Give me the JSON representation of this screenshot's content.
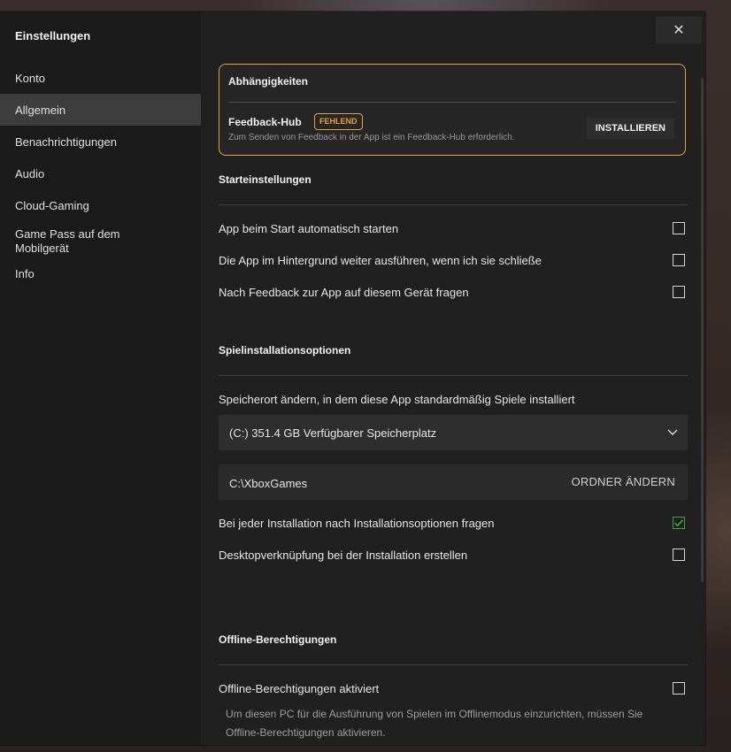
{
  "sidebar": {
    "title": "Einstellungen",
    "items": [
      {
        "label": "Konto"
      },
      {
        "label": "Allgemein"
      },
      {
        "label": "Benachrichtigungen"
      },
      {
        "label": "Audio"
      },
      {
        "label": "Cloud-Gaming"
      },
      {
        "label": "Game Pass auf dem Mobilgerät"
      },
      {
        "label": "Info"
      }
    ],
    "active": "Allgemein"
  },
  "window": {
    "close_icon": "close-icon",
    "close_glyph": "✕"
  },
  "dependencies": {
    "title": "Abhängigkeiten",
    "item_name": "Feedback-Hub",
    "badge": "FEHLEND",
    "description": "Zum Senden von Feedback in der App ist ein Feedback-Hub erforderlich.",
    "install_label": "INSTALLIEREN",
    "accent_color": "#e8a13a"
  },
  "startup": {
    "title": "Starteinstellungen",
    "options": [
      {
        "label": "App beim Start automatisch starten",
        "checked": false
      },
      {
        "label": "Die App im Hintergrund weiter ausführen, wenn ich sie schließe",
        "checked": false
      },
      {
        "label": "Nach Feedback zur App auf diesem Gerät fragen",
        "checked": false
      }
    ]
  },
  "install_options": {
    "title": "Spielinstallationsoptionen",
    "location_label": "Speicherort ändern, in dem diese App standardmäßig Spiele installiert",
    "drive_selected": "(C:) 351.4 GB Verfügbarer Speicherplatz",
    "path": "C:\\XboxGames",
    "change_folder_label": "ORDNER ÄNDERN",
    "options": [
      {
        "label": "Bei jeder Installation nach Installationsoptionen fragen",
        "checked": true
      },
      {
        "label": "Desktopverknüpfung bei der Installation erstellen",
        "checked": false
      }
    ],
    "check_color": "#3fa33f"
  },
  "offline": {
    "title": "Offline-Berechtigungen",
    "option": {
      "label": "Offline-Berechtigungen aktiviert",
      "checked": false
    },
    "help_text": "Um diesen PC für die Ausführung von Spielen im Offlinemodus einzurichten, müssen Sie Offline-Berechtigungen aktivieren."
  }
}
